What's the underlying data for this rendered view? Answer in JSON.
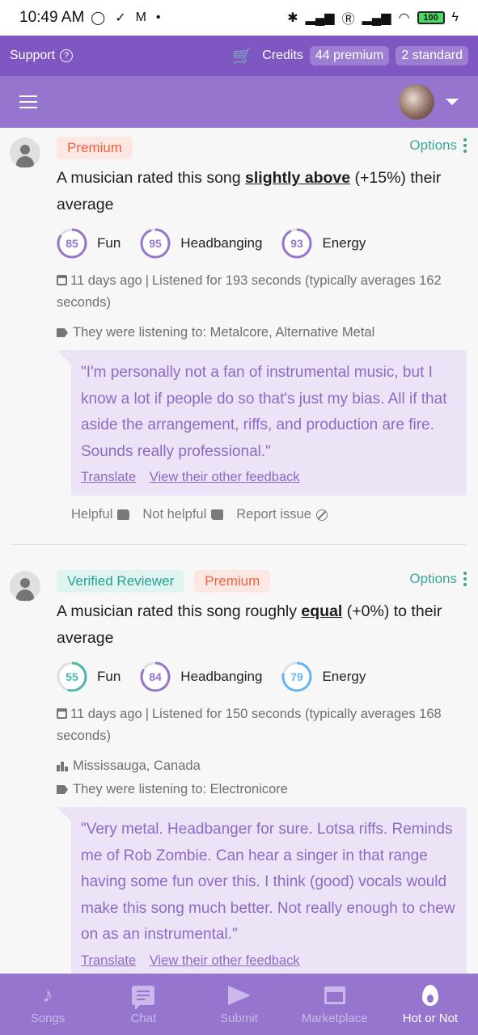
{
  "status_bar": {
    "time": "10:49 AM",
    "battery": "100"
  },
  "credits_bar": {
    "support_label": "Support",
    "credits_label": "Credits",
    "premium_chip": "44 premium",
    "standard_chip": "2 standard"
  },
  "colors": {
    "header": "#7e57c2",
    "nav": "#9575cd",
    "premium": "#f0623f",
    "verified": "#23a192",
    "quote_text": "#8e6ac4",
    "score_purple": "#9575cd",
    "score_teal": "#4db6ac",
    "score_blue": "#64b5f6"
  },
  "feedback": [
    {
      "badges": [
        "Premium"
      ],
      "options_label": "Options",
      "headline_prefix": "A musician rated this song ",
      "headline_emphasis": "slightly above",
      "headline_suffix": " (+15%) their average",
      "scores": [
        {
          "value": "85",
          "label": "Fun"
        },
        {
          "value": "95",
          "label": "Headbanging"
        },
        {
          "value": "93",
          "label": "Energy"
        }
      ],
      "date": "11 days ago",
      "listened": "Listened for 193 seconds (typically averages 162 seconds)",
      "genres": "They were listening to: Metalcore, Alternative Metal",
      "quote": "\"I'm personally not a fan of instrumental music, but I know a lot if people do so that's just my bias. All if that aside the arrangement, riffs, and production are fire. Sounds really professional.\"",
      "translate": "Translate",
      "other_feedback": "View their other feedback",
      "helpful": "Helpful",
      "not_helpful": "Not helpful",
      "report": "Report issue"
    },
    {
      "badges": [
        "Verified Reviewer",
        "Premium"
      ],
      "options_label": "Options",
      "headline_prefix": "A musician rated this song roughly ",
      "headline_emphasis": "equal",
      "headline_suffix": " (+0%) to their average",
      "scores": [
        {
          "value": "55",
          "label": "Fun"
        },
        {
          "value": "84",
          "label": "Headbanging"
        },
        {
          "value": "79",
          "label": "Energy"
        }
      ],
      "date": "11 days ago",
      "listened": "Listened for 150 seconds (typically averages 168 seconds)",
      "location": "Mississauga, Canada",
      "genres": "They were listening to: Electronicore",
      "quote": "\"Very metal. Headbanger for sure. Lotsa riffs. Reminds me of Rob Zombie. Can hear a singer in that range having some fun over this. I think (good) vocals would make this song much better. Not really enough to chew on as an instrumental.\"",
      "translate": "Translate",
      "other_feedback": "View their other feedback"
    }
  ],
  "bottom_nav": [
    {
      "label": "Songs",
      "icon": "music-note-icon"
    },
    {
      "label": "Chat",
      "icon": "chat-icon"
    },
    {
      "label": "Submit",
      "icon": "send-icon"
    },
    {
      "label": "Marketplace",
      "icon": "store-icon"
    },
    {
      "label": "Hot or Not",
      "icon": "flame-icon",
      "active": true
    }
  ]
}
